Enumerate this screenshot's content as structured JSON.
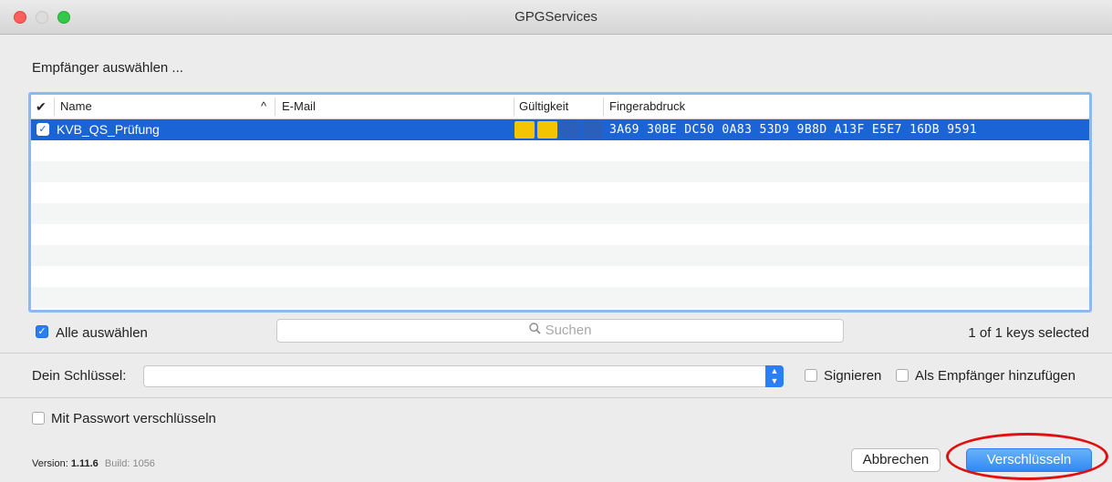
{
  "window": {
    "title": "GPGServices"
  },
  "recipients": {
    "heading": "Empfänger auswählen ...",
    "columns": {
      "check": "✔",
      "name": "Name",
      "sort": "^",
      "email": "E-Mail",
      "validity": "Gültigkeit",
      "fingerprint": "Fingerabdruck"
    },
    "rows": [
      {
        "name": "KVB_QS_Prüfung",
        "email": "",
        "fingerprint": "3A69 30BE DC50 0A83 53D9  9B8D A13F E5E7 16DB 9591",
        "selected": true,
        "validity_level": 2,
        "validity_max": 4
      }
    ],
    "select_all_label": "Alle auswählen",
    "search_placeholder": "Suchen",
    "keys_selected": "1 of 1 keys selected"
  },
  "signing": {
    "your_key_label": "Dein Schlüssel:",
    "your_key_value": "",
    "sign_label": "Signieren",
    "add_as_recipient_label": "Als Empfänger hinzufügen"
  },
  "password": {
    "label": "Mit Passwort verschlüsseln"
  },
  "footer": {
    "version_label": "Version:",
    "version": "1.11.6",
    "build_label": "Build:",
    "build": "1056",
    "cancel_label": "Abbrechen",
    "encrypt_label": "Verschlüsseln"
  },
  "colors": {
    "accent": "#2a7ef6",
    "selection": "#1b64d6",
    "validity": "#f5c400",
    "highlight_circle": "#e01010"
  }
}
